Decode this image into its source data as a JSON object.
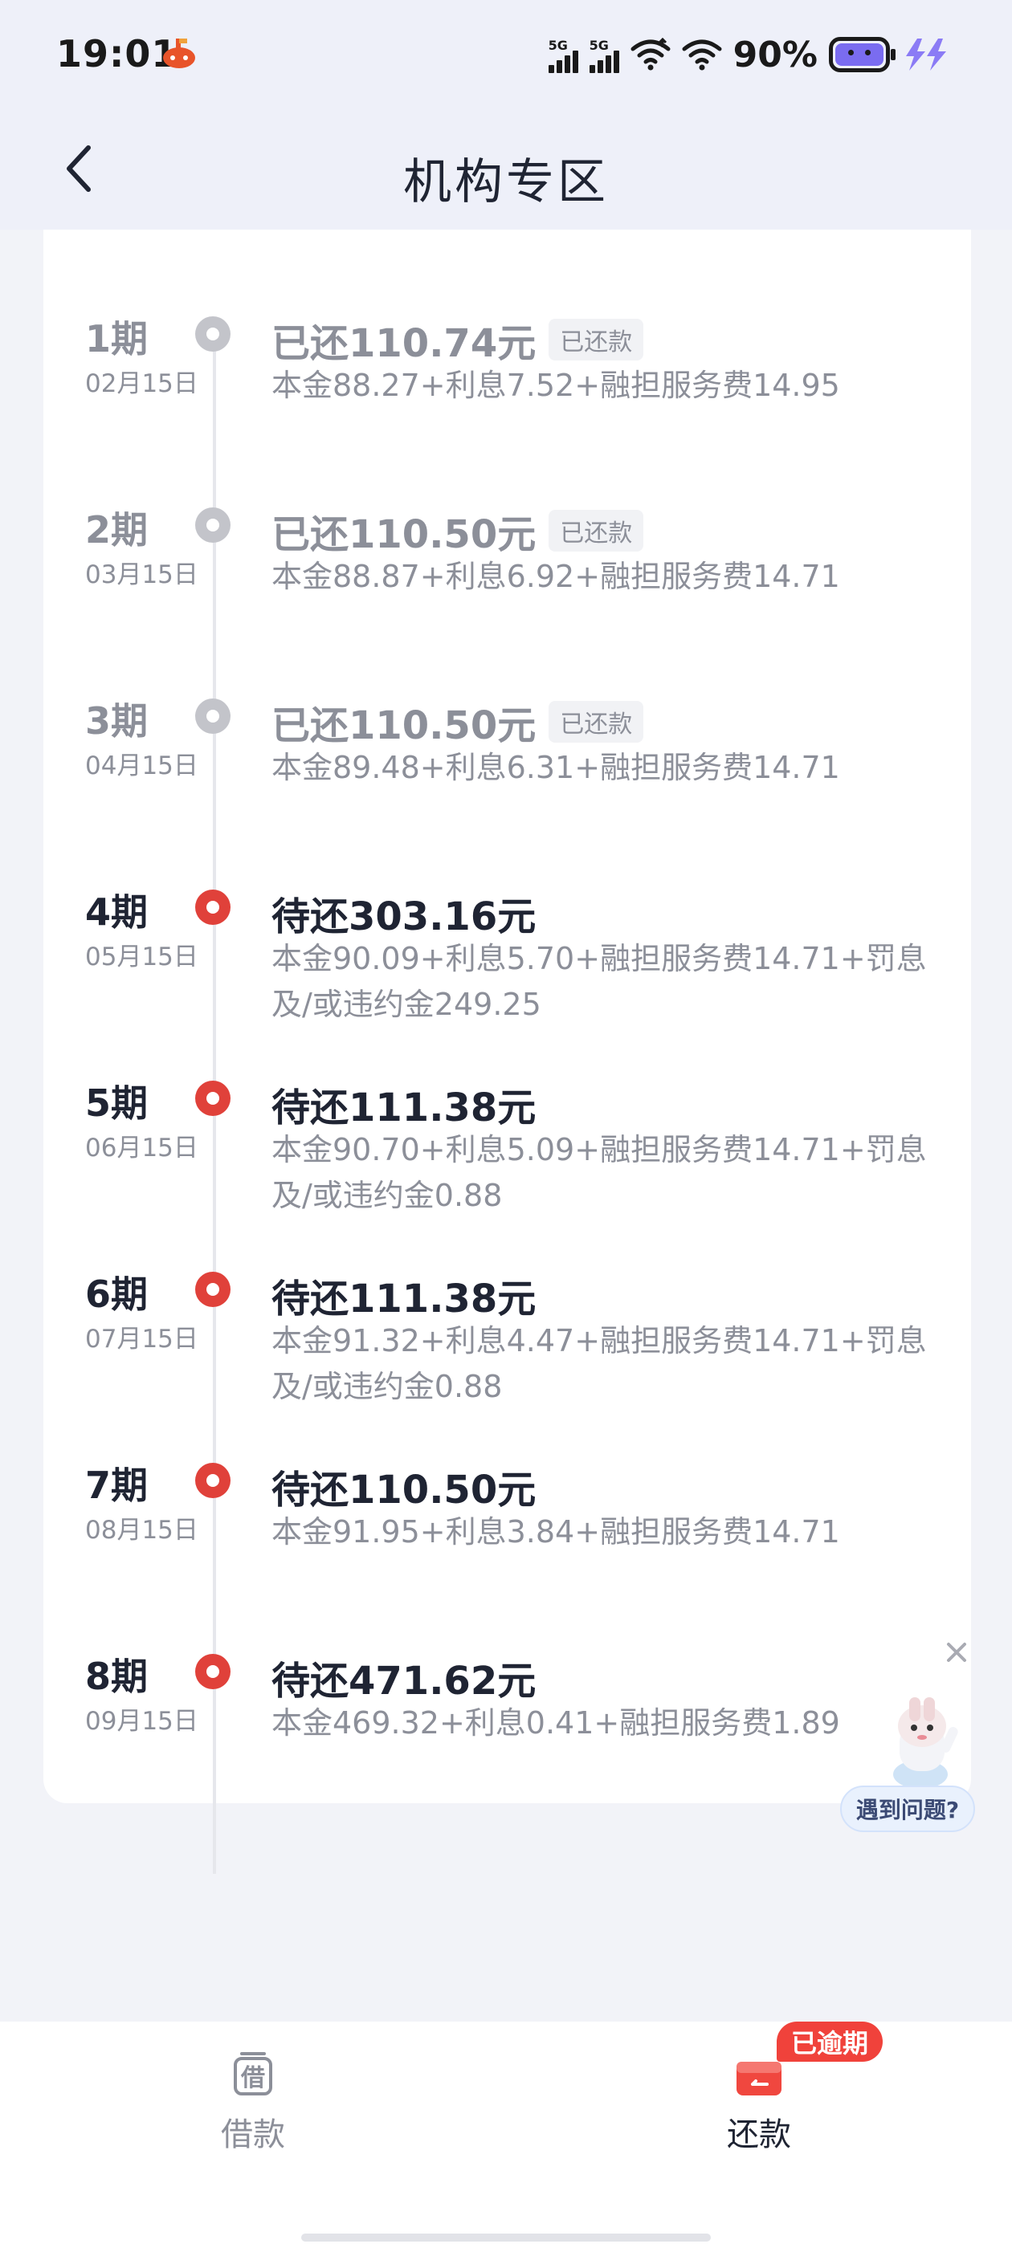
{
  "status_bar": {
    "time": "19:01",
    "signal_tags": [
      "5G",
      "5G"
    ],
    "battery_percent": "90%",
    "battery_level": 0.9,
    "icons": [
      "app-notification-icon",
      "signal-icon",
      "signal-icon",
      "wifi-icon",
      "wifi-icon",
      "battery-icon",
      "charging-icon"
    ]
  },
  "nav": {
    "title": "机构专区",
    "back_icon": "chevron-left-icon"
  },
  "schedule": [
    {
      "period": "1期",
      "date": "02月15日",
      "amount": "已还110.74元",
      "badge": "已还款",
      "detail": "本金88.27+利息7.52+融担服务费14.95",
      "status": "paid"
    },
    {
      "period": "2期",
      "date": "03月15日",
      "amount": "已还110.50元",
      "badge": "已还款",
      "detail": "本金88.87+利息6.92+融担服务费14.71",
      "status": "paid"
    },
    {
      "period": "3期",
      "date": "04月15日",
      "amount": "已还110.50元",
      "badge": "已还款",
      "detail": "本金89.48+利息6.31+融担服务费14.71",
      "status": "paid"
    },
    {
      "period": "4期",
      "date": "05月15日",
      "amount": "待还303.16元",
      "badge": "",
      "detail": "本金90.09+利息5.70+融担服务费14.71+罚息及/或违约金249.25",
      "status": "due"
    },
    {
      "period": "5期",
      "date": "06月15日",
      "amount": "待还111.38元",
      "badge": "",
      "detail": "本金90.70+利息5.09+融担服务费14.71+罚息及/或违约金0.88",
      "status": "due"
    },
    {
      "period": "6期",
      "date": "07月15日",
      "amount": "待还111.38元",
      "badge": "",
      "detail": "本金91.32+利息4.47+融担服务费14.71+罚息及/或违约金0.88",
      "status": "due"
    },
    {
      "period": "7期",
      "date": "08月15日",
      "amount": "待还110.50元",
      "badge": "",
      "detail": "本金91.95+利息3.84+融担服务费14.71",
      "status": "due"
    },
    {
      "period": "8期",
      "date": "09月15日",
      "amount": "待还471.62元",
      "badge": "",
      "detail": "本金469.32+利息0.41+融担服务费1.89",
      "status": "due"
    }
  ],
  "helper": {
    "label": "遇到问题?",
    "close_icon": "close-icon",
    "avatar_icon": "mascot-icon"
  },
  "tabs": {
    "borrow": {
      "label": "借款",
      "icon_text": "借"
    },
    "repay": {
      "label": "还款",
      "badge": "已逾期"
    }
  },
  "colors": {
    "accent_red": "#e0413a",
    "paid_gray": "#c3c4ca",
    "text_dark": "#1f2433",
    "text_gray": "#8c8f99",
    "background": "#f2f3f8"
  }
}
